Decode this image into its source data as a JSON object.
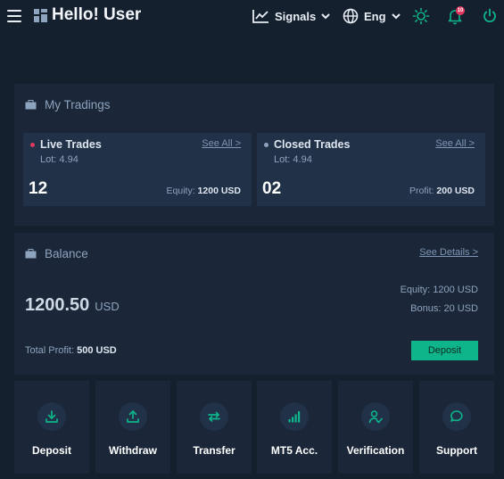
{
  "header": {
    "title": "Hello! User",
    "signals_label": "Signals",
    "language_label": "Eng",
    "notification_count": "10"
  },
  "tradings": {
    "title": "My Tradings",
    "live": {
      "title": "Live Trades",
      "link": "See All >",
      "lot": "Lot: 4.94",
      "count": "12",
      "metric_label": "Equity:",
      "metric_value": "1200 USD"
    },
    "closed": {
      "title": "Closed Trades",
      "link": "See All >",
      "lot": "Lot: 4.94",
      "count": "02",
      "metric_label": "Profit:",
      "metric_value": "200 USD"
    }
  },
  "balance": {
    "title": "Balance",
    "details_link": "See Details >",
    "amount": "1200.50",
    "currency": "USD",
    "equity": "Equity: 1200 USD",
    "bonus": "Bonus: 20 USD",
    "total_profit_label": "Total Profit:",
    "total_profit_value": "500 USD",
    "deposit_button": "Deposit"
  },
  "actions": [
    {
      "label": "Deposit",
      "icon": "download-icon"
    },
    {
      "label": "Withdraw",
      "icon": "upload-icon"
    },
    {
      "label": "Transfer",
      "icon": "transfer-arrows-icon"
    },
    {
      "label": "MT5 Acc.",
      "icon": "signal-bars-icon"
    },
    {
      "label": "Verification",
      "icon": "user-check-icon"
    },
    {
      "label": "Support",
      "icon": "chat-bubble-icon"
    }
  ],
  "colors": {
    "background": "#15202e",
    "panel": "#1b2738",
    "card": "#213148",
    "accent": "#0eb58a",
    "live_dot": "#e0385f",
    "closed_dot": "#8ea3be"
  }
}
